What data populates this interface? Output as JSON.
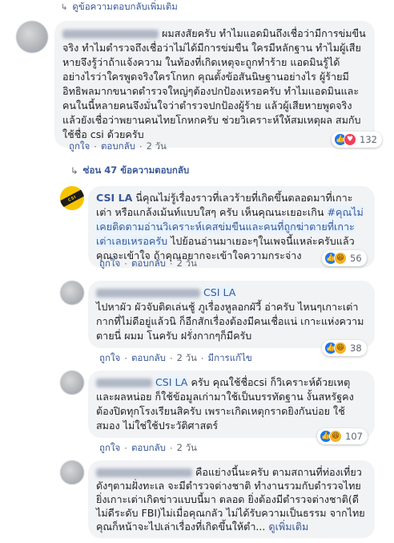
{
  "top_more_replies": "ดูข้อความตอบกลับเพิ่มเติม",
  "comments": [
    {
      "author": "",
      "text": "ผมสงสัยครับ ทำไมแอดมินถึงเชื่อว่ามีการข่มขืน จริง ทำไมตำรวจถึงเชื่อว่าไม่ได้มีการข่มขืน ใครมีหลักฐาน ทำไมผู้เสียหายจึงรู้ว่าถ้าแจ้งความ ในท้องที่เกิดเหตุจะถูกทำร้าย แอดมินรู้ได้อย่างไรว่าใครพูดจริงใครโกหก คุณตั้งข้อสันนิษฐานอย่างไร ผู้ร้ายมีอิทธิพลมากขนาดตำรวจใหญ่ๆต้องปกป้องเหรอครับ ทำไมแอดมินและคนในนี้หลายคนจึงมั่นใจว่าตำรวจปกป้องผู้ร้าย แล้วผู้เสียหายพูดจริง แล้วยังเชื่อว่าพยานคนไทยโกหกครับ ช่วยวิเคราะห์ให้สมเหตุผล สมกับใช้ชื่อ csi ด้วยครับ",
      "actions": {
        "like": "ถูกใจ",
        "reply": "ตอบกลับ",
        "time": "2 วัน"
      },
      "reaction_count": "132"
    }
  ],
  "replies_toggle": "ซ่อน 47 ข้อความตอบกลับ",
  "replies": [
    {
      "author": "CSI LA",
      "text_parts": {
        "pre": "นี่คุณไม่รู้เรื่องราวที่เลวร้ายที่เกิดขึ้นตลอดมาที่เกาะเต่า หรือแกล้งเม้นท์แบบใสๆ ครับ เห็นคุณนะเยอะเกิน ",
        "hashtag": "#คุณไม่เคยติดตามอ่านวิเคราะห์เคสข่มขืนและคนที่ถูกฆ่าตายที่เกาะเต่าเลยเหรอครับ",
        "post": " ไปย้อนอ่านมาเยอะๆในเพจนี้แหล่ะครับแล้วคุณจะเข้าใจ ถ้าคุณอยากจะเข้าใจความกระจ่าง"
      },
      "actions": {
        "like": "ถูกใจ",
        "reply": "ตอบกลับ",
        "time": "2 วัน"
      },
      "reaction_count": "56"
    },
    {
      "mention": "CSI LA",
      "text": "ไปหาผัว ผัวจับติดเล่นชู้ ภูเรื่องหูลอกผัวี้ อ่าครับ ไหนๆเกาะเต่ากากที่ไม่ดีอยู่แล้วนิ ก็อีกสักเรื่องต้องมีคนเชื่อแน่ เกาะแห่งความตายนี่ ผมม โนครับ ฝรั่งกากๆก็มีครับ",
      "actions": {
        "like": "ถูกใจ",
        "reply": "ตอบกลับ",
        "time": "2 วัน",
        "edited": "มีการแก้ไข"
      },
      "reaction_count": "38"
    },
    {
      "mention": "CSI LA",
      "text": "ครับ คุณใช้ชื่อcsi ก็วิเคราะห์ด้วยเหตุและผลหน่อย ก็ใช้ข้อมูลเก่ามาใช้เป็นบรรทัดฐาน งั้นสหรัฐคงต้องปิดทุกโรงเรียนสิครับ เพราะเกิดเหตุกราดยิงกันบ่อย ใช้สมอง ไม่ใช่ใช้ประวัติศาสตร์",
      "actions": {
        "like": "ถูกใจ",
        "reply": "ตอบกลับ",
        "time": "2 วัน"
      },
      "reaction_count": "107"
    },
    {
      "text": "คือแย่างนี้นะครับ ตามสถานที่ท่องเที่ยวดังๆตามฝั่งทะเล จะมีตำรวจต่างชาติ ทำงานรวมกับตำรวจไทย ยิ่งเกาะเต่าเกิดข่าวแบบนี้มา ตลอด ยิ่งต้องมีตำรวจต่างชาติ(ดีไม่ดีระดับ FBI)ไม่เมื่อคุณกลัว ไม่ได้รับความเป็นธรรม จากไทย คุณก็หน้าจะไปเล่าเรื่องที่เกิดขึ้นให้ตำ...",
      "see_more": "ดูเพิ่มเติม"
    }
  ],
  "colors": {
    "link": "#385898",
    "bubble": "#f2f3f5",
    "like": "#1877f2",
    "love": "#f33e58",
    "haha": "#f7b125"
  }
}
